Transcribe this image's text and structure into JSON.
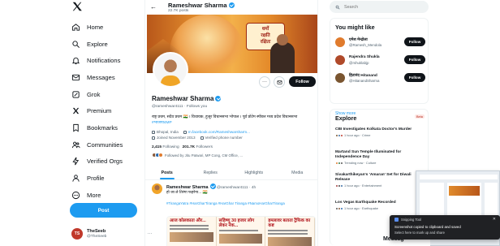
{
  "sidebar": {
    "nav": [
      {
        "label": "Home",
        "icon": "home-icon"
      },
      {
        "label": "Explore",
        "icon": "search-icon"
      },
      {
        "label": "Notifications",
        "icon": "bell-icon"
      },
      {
        "label": "Messages",
        "icon": "mail-icon"
      },
      {
        "label": "Grok",
        "icon": "grok-icon"
      },
      {
        "label": "Premium",
        "icon": "x-premium-icon"
      },
      {
        "label": "Bookmarks",
        "icon": "bookmark-icon"
      },
      {
        "label": "Communities",
        "icon": "people-icon"
      },
      {
        "label": "Verified Orgs",
        "icon": "lightning-icon"
      },
      {
        "label": "Profile",
        "icon": "person-icon"
      },
      {
        "label": "More",
        "icon": "more-circle-icon"
      }
    ],
    "post_button": "Post",
    "account": {
      "name": "TheSeeb",
      "handle": "@TheSeeb",
      "avatar_text": "TS"
    }
  },
  "header": {
    "name": "Rameshwar Sharma",
    "posts": "22.7K posts"
  },
  "banner": {
    "headline": [
      "धर्मो",
      "रक्षति",
      "रक्षितः"
    ]
  },
  "profile": {
    "name": "Rameshwar Sharma",
    "handle": "@rameshwar4111 · Follows you",
    "bio": "राष्ट्र प्रथम, सदैव प्रथम 🇮🇳 । विधायक, हुजूर विधानसभा भोपाल । पूर्व प्रोटेम स्पीकर मध्य प्रदेश विधानसभा",
    "bio_tag": "#भाजपा4MP",
    "location": "Bhopal, India",
    "website": "m.facebook.com/Rameshwarsharm...",
    "joined": "Joined November 2013",
    "verified_phone": "Verified phone number",
    "following_count": "2,415",
    "following_label": "Following",
    "followers_count": "201.7K",
    "followers_label": "Followers",
    "followed_by": "Followed by Jitu Patwari, MP Cong, CM Office, ...",
    "follow_button": "Follow"
  },
  "tabs": [
    "Posts",
    "Replies",
    "Highlights",
    "Media"
  ],
  "tweet": {
    "name": "Rameshwar Sharma",
    "handle": "@rameshwar4111 · 4h",
    "text": "हो जा ले तिरंगा फहरेगा... 🇮🇳",
    "tags": "#TirangaYatra #HarGharTiranga #HarGhar Tiranga #NamoHarGharTiranga",
    "image_headlines": [
      "आज कोलकाता और...",
      "सहिष्णु 30 हजार लोग लेकर नेक...",
      "हमलावर बताता ट्रैफिक का कष्ट"
    ]
  },
  "search": {
    "placeholder": "Search"
  },
  "you_might_like": {
    "title": "You might like",
    "people": [
      {
        "name": "एमेश मेन्द्रोला",
        "handle": "@Ramesh_Mendola",
        "color": "#e07b2d"
      },
      {
        "name": "Rajendra Shukla",
        "handle": "@rshuklabjp",
        "color": "#b04a2a"
      },
      {
        "name": "हितानंद Hitanand",
        "handle": "@HitanandSharma",
        "color": "#7a5530"
      }
    ],
    "follow_label": "Follow",
    "show_more": "Show more"
  },
  "explore": {
    "title": "Explore",
    "badge": "Beta",
    "items": [
      {
        "title": "CBI Investigates Kolkata Doctor's Murder",
        "meta": "1 hour ago · Crime"
      },
      {
        "title": "Martand Sun Temple Illuminated for Independence Day",
        "meta": "Trending now · Culture"
      },
      {
        "title": "Sivakarthikeyan's 'Amaran' Set for Diwali Release",
        "meta": "1 hour ago · Entertainment"
      },
      {
        "title": "Los Vegas Earthquake Recorded",
        "meta": "1 hour ago · Earthquake"
      }
    ]
  },
  "toast": {
    "app": "Snipping Tool",
    "message": "Screenshot copied to clipboard and saved",
    "sub": "Select here to mark up and share"
  },
  "messages_bar": "Messag"
}
